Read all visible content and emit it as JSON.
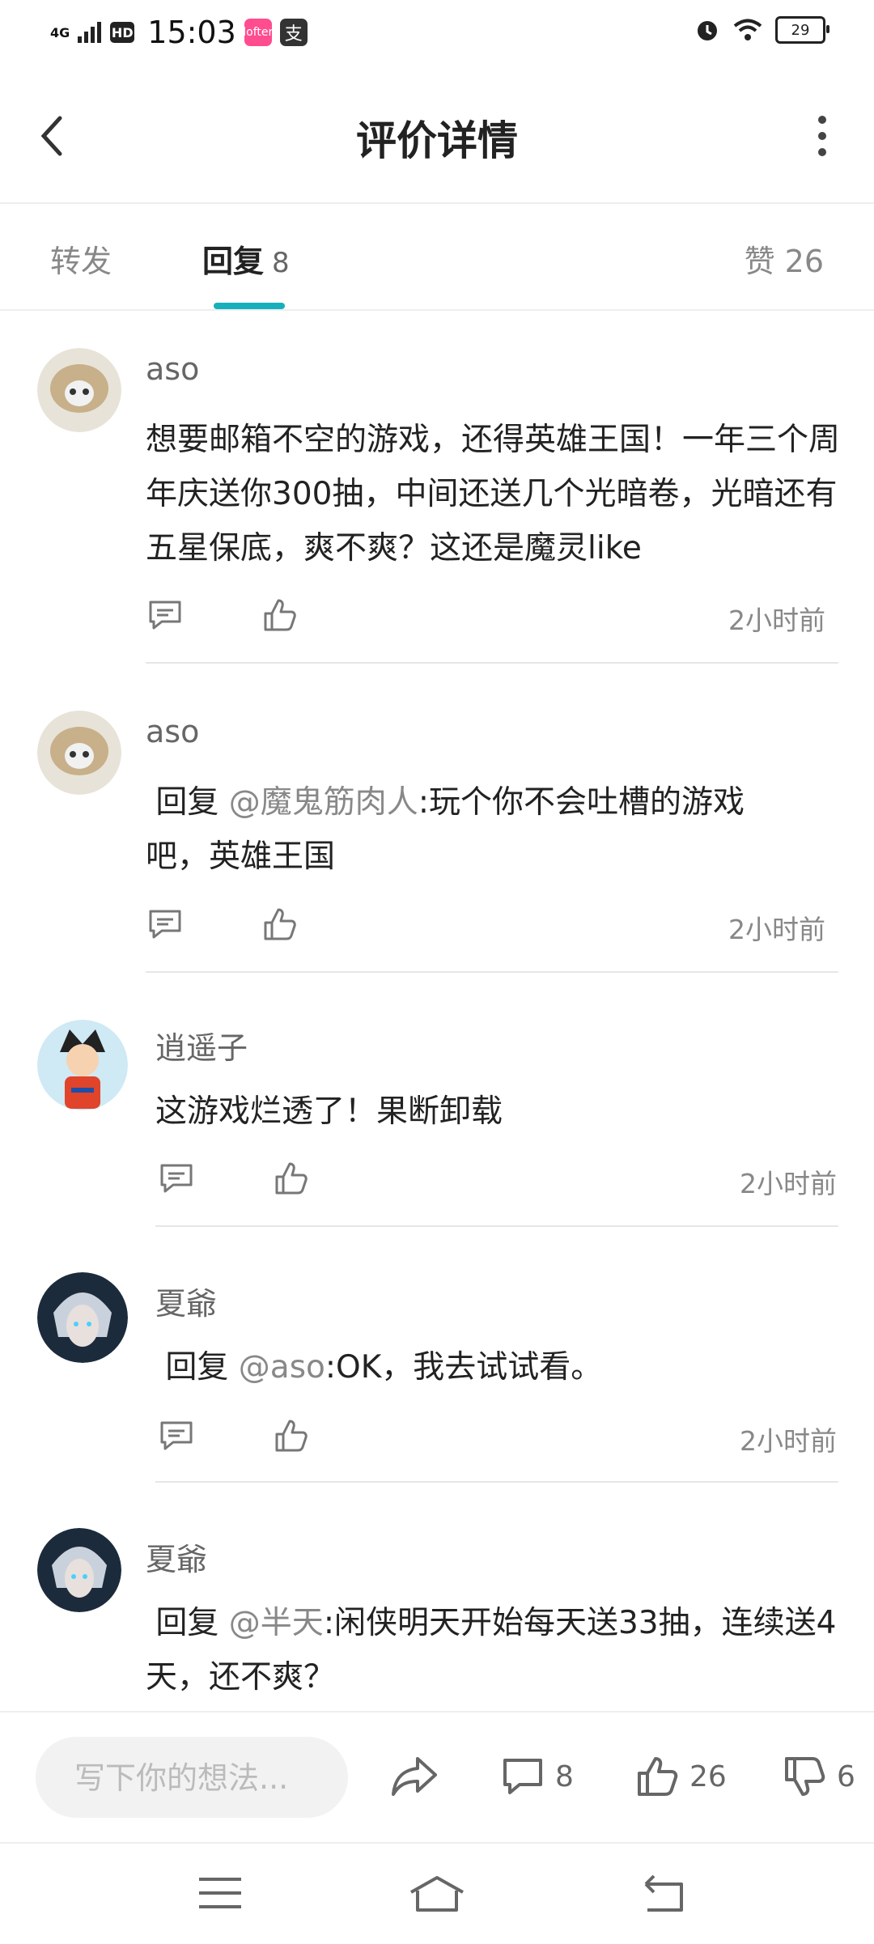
{
  "status": {
    "signal": "4G",
    "hd": "HD",
    "time": "15:03",
    "battery": "29",
    "app_icons": [
      "lofter-icon",
      "zhi-icon"
    ],
    "app_icon_chars": [
      "lofter",
      "支"
    ]
  },
  "header": {
    "title": "评价详情"
  },
  "tabs": {
    "forward": "转发",
    "reply": "回复",
    "reply_count": "8",
    "like_label": "赞 26",
    "accent": "#16b0bd"
  },
  "comments": [
    {
      "name": "aso",
      "text": "想要邮箱不空的游戏，还得英雄王国！一年三个周年庆送你300抽，中间还送几个光暗卷，光暗还有五星保底，爽不爽？这还是魔灵like",
      "time": "2小时前"
    },
    {
      "name": "aso",
      "reply_prefix": " 回复 ",
      "mention": "@魔鬼筋肉人",
      "text": ":玩个你不会吐槽的游戏吧，英雄王国",
      "time": "2小时前"
    },
    {
      "name": "逍遥子",
      "text": "这游戏烂透了！果断卸载",
      "time": "2小时前"
    },
    {
      "name": "夏爺",
      "reply_prefix": " 回复 ",
      "mention": "@aso",
      "text": ":OK，我去试试看。",
      "time": "2小时前"
    },
    {
      "name": "夏爺",
      "reply_prefix": " 回复 ",
      "mention": "@半天",
      "text": ":闲侠明天开始每天送33抽，连续送4天，还不爽？"
    }
  ],
  "bottom": {
    "placeholder": "写下你的想法...",
    "comment_count": "8",
    "like_count": "26",
    "dislike_count": "6"
  }
}
